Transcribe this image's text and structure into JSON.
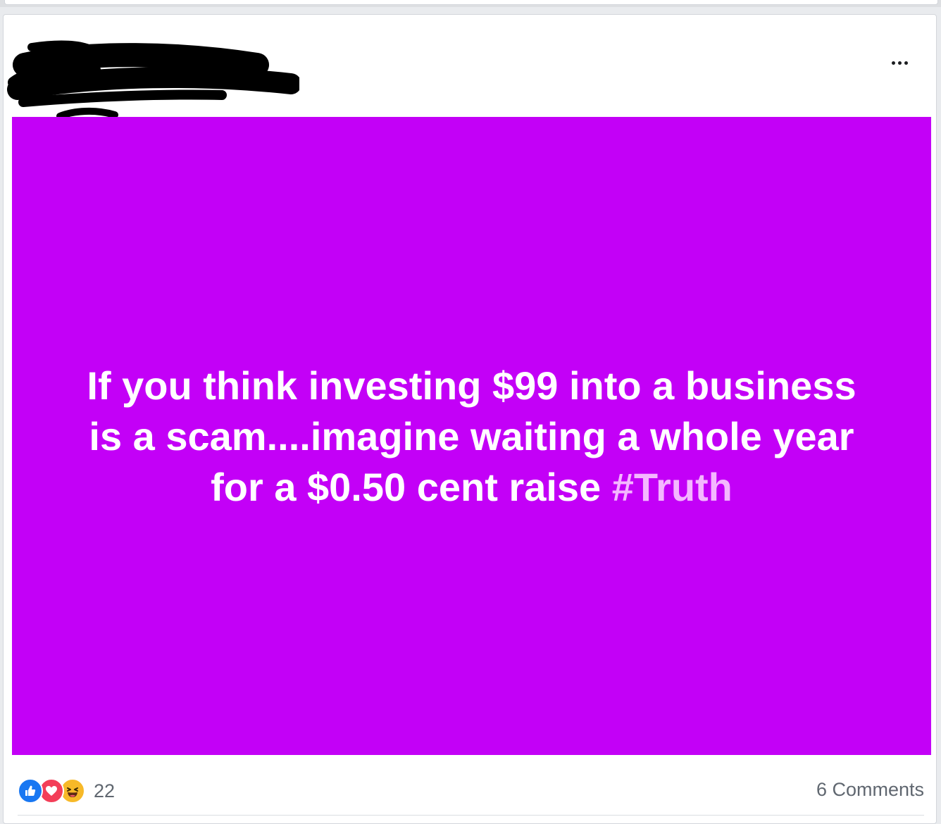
{
  "post": {
    "author_redacted": true,
    "more_options_icon": "ellipsis-horizontal-icon",
    "background_color": "#c300f7",
    "text_color": "#ffffff",
    "hashtag_color": "#f4b7ff",
    "text_line_1": "If you think investing $99 into a business",
    "text_line_2": "is a scam....imagine waiting a whole year",
    "text_line_3": "for a $0.50 cent raise ",
    "hashtag": "#Truth"
  },
  "footer": {
    "reactions": [
      {
        "type": "like",
        "icon": "thumbs-up-icon",
        "color": "#1877f2"
      },
      {
        "type": "love",
        "icon": "heart-icon",
        "color": "#f33e58"
      },
      {
        "type": "haha",
        "icon": "laughing-face-icon",
        "color": "#f7b928"
      }
    ],
    "reaction_count": "22",
    "comments_label": "6 Comments"
  }
}
